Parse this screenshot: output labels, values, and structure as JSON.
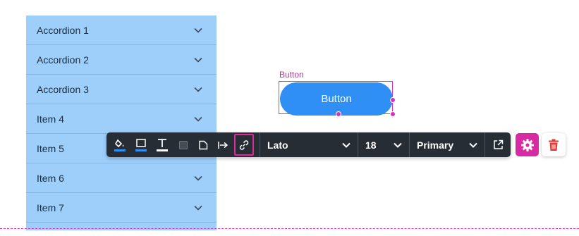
{
  "accordion": {
    "items": [
      {
        "label": "Accordion 1"
      },
      {
        "label": "Accordion 2"
      },
      {
        "label": "Accordion 3"
      },
      {
        "label": "Item 4"
      },
      {
        "label": "Item 5"
      },
      {
        "label": "Item 6"
      },
      {
        "label": "Item 7"
      }
    ],
    "background": "#9ecffb",
    "chevron_icon": "chevron-down-icon"
  },
  "selected_element": {
    "caption": "Button",
    "label": "Button",
    "color": "#2f8ff5",
    "selection_color": "#d633c4"
  },
  "toolbar": {
    "tools": [
      {
        "name": "fill-color",
        "icon": "paint-bucket-icon"
      },
      {
        "name": "border-color",
        "icon": "border-box-icon"
      },
      {
        "name": "text-color",
        "icon": "text-color-icon"
      },
      {
        "name": "shadow",
        "icon": "square-icon"
      },
      {
        "name": "shape",
        "icon": "folded-corner-icon"
      },
      {
        "name": "alignment",
        "icon": "align-left-bar-icon"
      },
      {
        "name": "link",
        "icon": "link-icon",
        "active": true
      }
    ],
    "font_family": "Lato",
    "font_size": "18",
    "style": "Primary",
    "open_external_icon": "external-link-icon",
    "settings_icon": "gear-icon",
    "delete_icon": "trash-icon",
    "accent": "#d82aa5",
    "delete_color": "#e53935"
  }
}
